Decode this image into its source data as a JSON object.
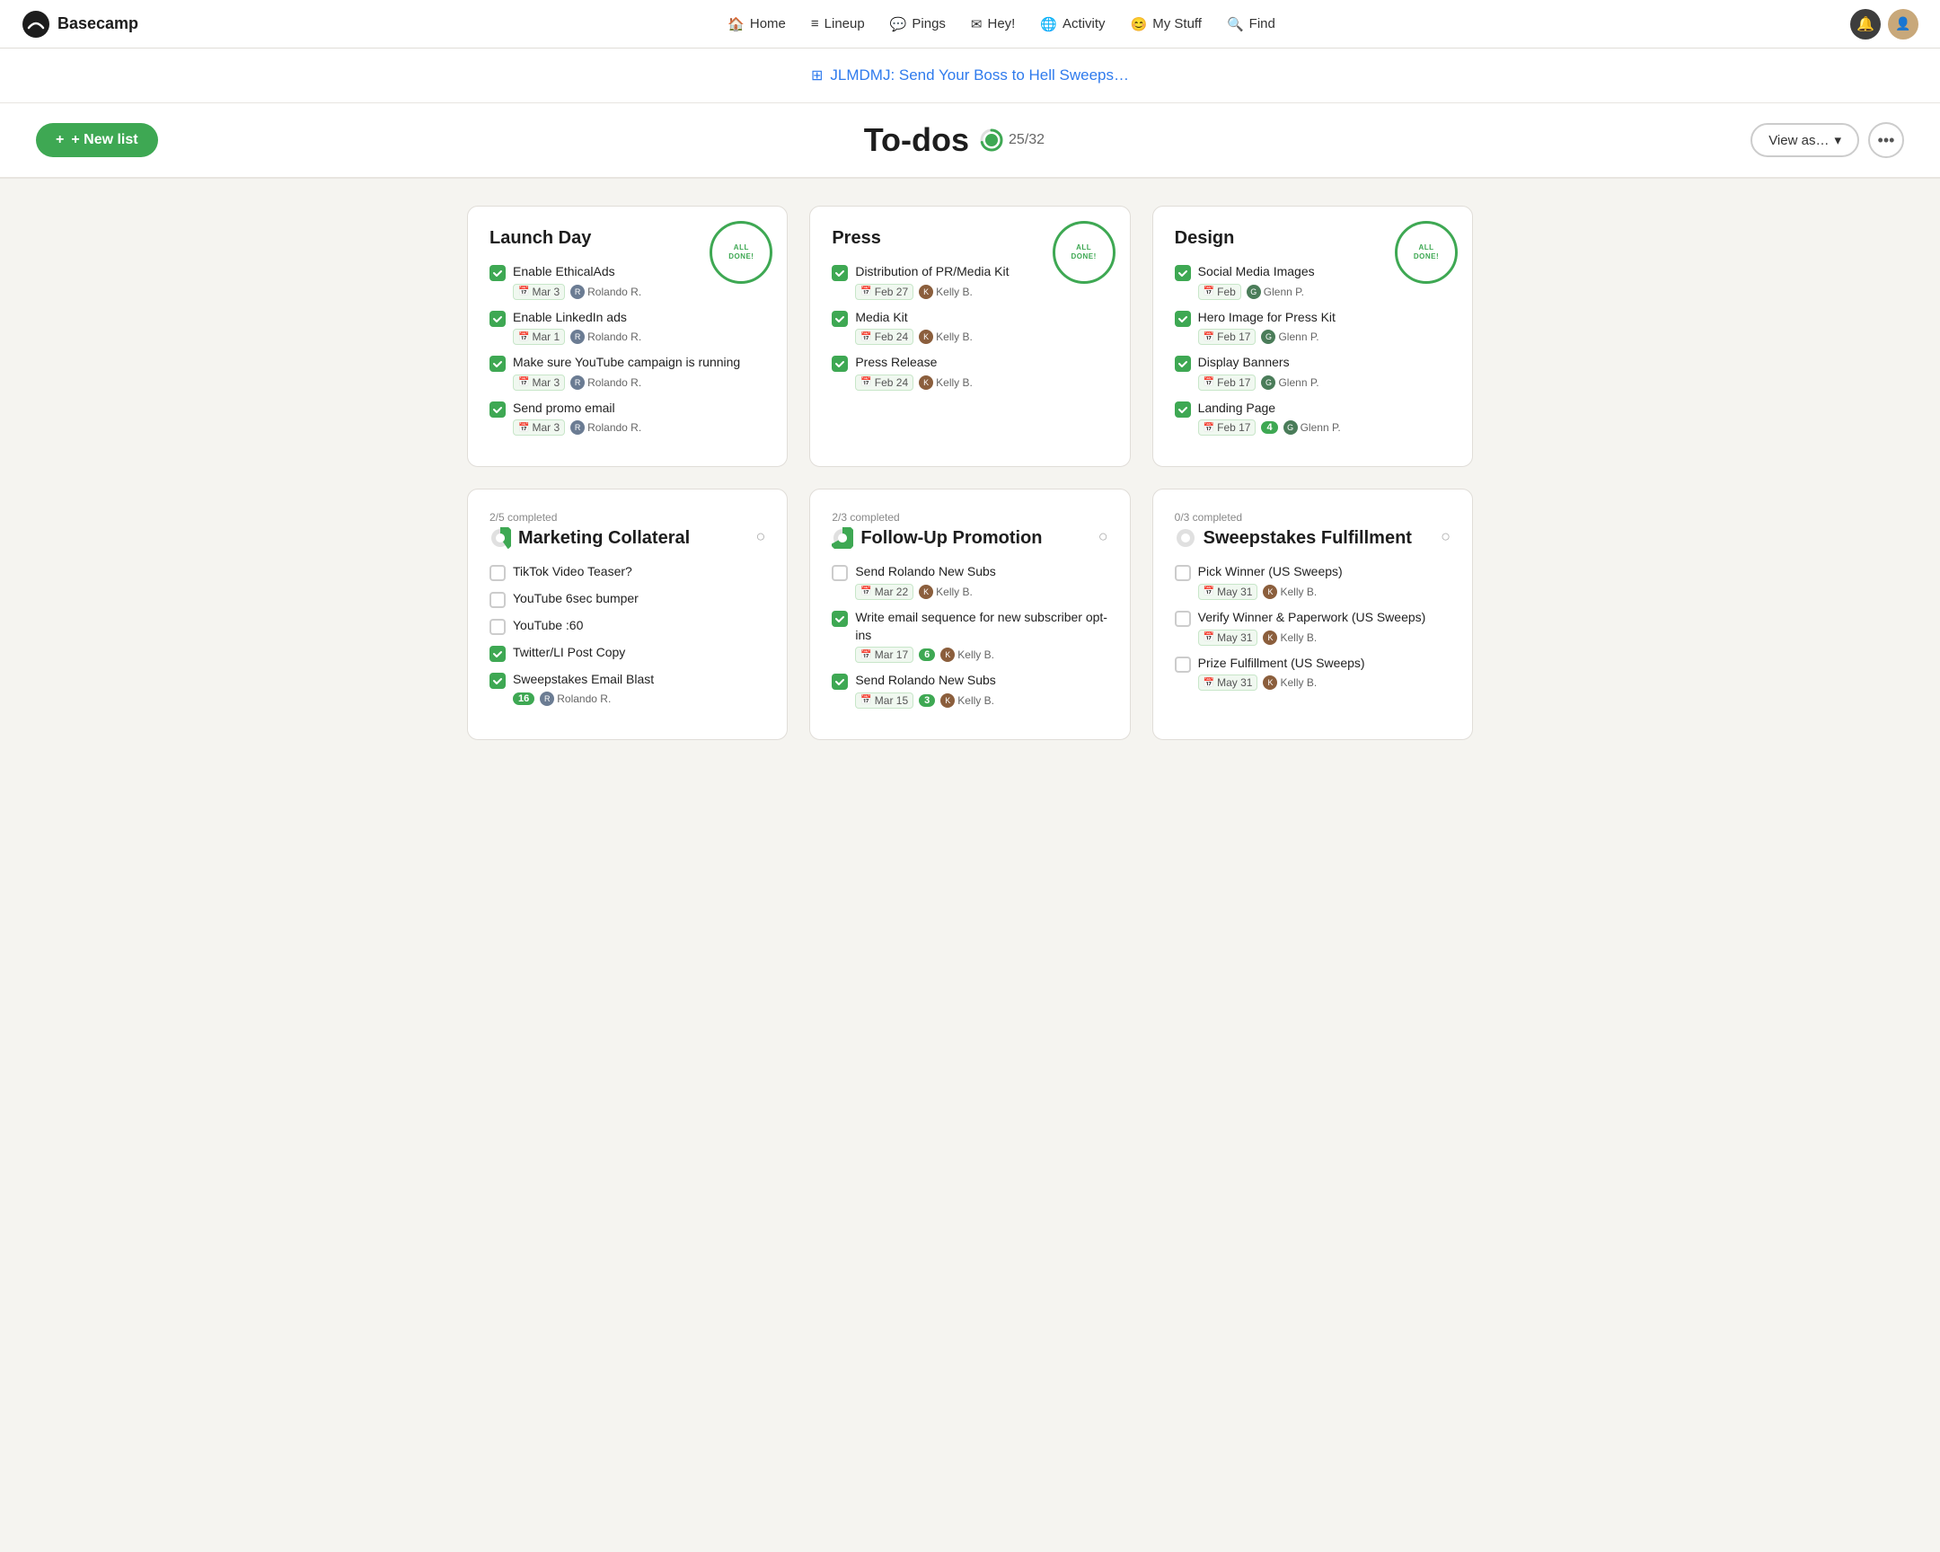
{
  "nav": {
    "logo": "Basecamp",
    "links": [
      {
        "label": "Home",
        "icon": "🏠"
      },
      {
        "label": "Lineup",
        "icon": "≡"
      },
      {
        "label": "Pings",
        "icon": "💬"
      },
      {
        "label": "Hey!",
        "icon": "✉"
      },
      {
        "label": "Activity",
        "icon": "🌐"
      },
      {
        "label": "My Stuff",
        "icon": "😊"
      },
      {
        "label": "Find",
        "icon": "🔍"
      }
    ]
  },
  "banner": {
    "text": "JLMDMJ: Send Your Boss to Hell Sweeps…"
  },
  "header": {
    "new_list_label": "+ New list",
    "title": "To-dos",
    "progress": "25/32",
    "view_as_label": "View as…",
    "more_label": "•••"
  },
  "cards": [
    {
      "id": "launch-day",
      "title": "Launch Day",
      "all_done": true,
      "completed": true,
      "items": [
        {
          "text": "Enable EthicalAds",
          "done": true,
          "date": "Mar 3",
          "assignee": "Rolando R.",
          "avatar": "R"
        },
        {
          "text": "Enable LinkedIn ads",
          "done": true,
          "date": "Mar 1",
          "assignee": "Rolando R.",
          "avatar": "R"
        },
        {
          "text": "Make sure YouTube campaign is running",
          "done": true,
          "date": "Mar 3",
          "assignee": "Rolando R.",
          "avatar": "R"
        },
        {
          "text": "Send promo email",
          "done": true,
          "date": "Mar 3",
          "assignee": "Rolando R.",
          "avatar": "R"
        }
      ]
    },
    {
      "id": "press",
      "title": "Press",
      "all_done": true,
      "completed": true,
      "items": [
        {
          "text": "Distribution of PR/Media Kit",
          "done": true,
          "date": "Feb 27",
          "assignee": "Kelly B.",
          "avatar": "K"
        },
        {
          "text": "Media Kit",
          "done": true,
          "date": "Feb 24",
          "assignee": "Kelly B.",
          "avatar": "K"
        },
        {
          "text": "Press Release",
          "done": true,
          "date": "Feb 24",
          "assignee": "Kelly B.",
          "avatar": "K"
        }
      ]
    },
    {
      "id": "design",
      "title": "Design",
      "all_done": true,
      "completed": true,
      "items": [
        {
          "text": "Social Media Images",
          "done": true,
          "date": "Feb",
          "assignee": "Glenn P.",
          "avatar": "G"
        },
        {
          "text": "Hero Image for Press Kit",
          "done": true,
          "date": "Feb 17",
          "assignee": "Glenn P.",
          "avatar": "G"
        },
        {
          "text": "Display Banners",
          "done": true,
          "date": "Feb 17",
          "assignee": "Glenn P.",
          "avatar": "G"
        },
        {
          "text": "Landing Page",
          "done": true,
          "date": "Feb 17",
          "assignee": "Glenn P.",
          "avatar": "G",
          "badge": "4"
        }
      ]
    },
    {
      "id": "marketing-collateral",
      "title": "Marketing Collateral",
      "all_done": false,
      "progress_label": "2/5 completed",
      "items": [
        {
          "text": "TikTok Video Teaser?",
          "done": false,
          "date": null,
          "assignee": null
        },
        {
          "text": "YouTube 6sec bumper",
          "done": false,
          "date": null,
          "assignee": null
        },
        {
          "text": "YouTube :60",
          "done": false,
          "date": null,
          "assignee": null
        },
        {
          "text": "Twitter/LI Post Copy",
          "done": true,
          "date": null,
          "assignee": null
        },
        {
          "text": "Sweepstakes Email Blast",
          "done": true,
          "date": null,
          "assignee": "Rolando R.",
          "avatar": "R",
          "badge": "16"
        }
      ]
    },
    {
      "id": "follow-up-promotion",
      "title": "Follow-Up Promotion",
      "all_done": false,
      "progress_label": "2/3 completed",
      "items": [
        {
          "text": "Send Rolando New Subs",
          "done": false,
          "date": "Mar 22",
          "assignee": "Kelly B.",
          "avatar": "K"
        },
        {
          "text": "Write email sequence for new subscriber opt-ins",
          "done": true,
          "date": "Mar 17",
          "assignee": "Kelly B.",
          "avatar": "K",
          "badge": "6"
        },
        {
          "text": "Send Rolando New Subs",
          "done": true,
          "date": "Mar 15",
          "assignee": "Kelly B.",
          "avatar": "K",
          "badge": "3"
        }
      ]
    },
    {
      "id": "sweepstakes-fulfillment",
      "title": "Sweepstakes Fulfillment",
      "all_done": false,
      "progress_label": "0/3 completed",
      "items": [
        {
          "text": "Pick Winner (US Sweeps)",
          "done": false,
          "date": "May 31",
          "assignee": "Kelly B.",
          "avatar": "K"
        },
        {
          "text": "Verify Winner & Paperwork (US Sweeps)",
          "done": false,
          "date": "May 31",
          "assignee": "Kelly B.",
          "avatar": "K"
        },
        {
          "text": "Prize Fulfillment (US Sweeps)",
          "done": false,
          "date": "May 31",
          "assignee": "Kelly B.",
          "avatar": "K"
        }
      ]
    }
  ]
}
